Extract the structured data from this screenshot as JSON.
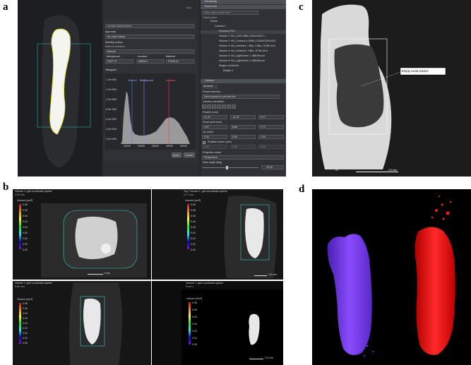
{
  "labels": {
    "a": "a",
    "b": "b",
    "c": "c",
    "d": "d"
  },
  "panel_a": {
    "input_placeholder": "Surface determination",
    "approach_label": "Approach",
    "approach_value": "Iso value based",
    "starting_contour_label": "Starting contour",
    "material_def_label": "Material definition",
    "material_def_value": "Manual",
    "background_label": "Background",
    "isovalue_label": "Isovalue",
    "material_label": "Material",
    "background_value": "10077.9",
    "isovalue_value": "26698.3",
    "material_value": "57518.31",
    "histogram_label": "Histogram",
    "hist_ylabels": [
      "1.4e+004",
      "1.2e+004",
      "1.0e+004",
      "8.0e+003",
      "6.0e+003",
      "4.0e+003",
      "2.0e+003"
    ],
    "hist_xlabels": [
      "10000",
      "20000",
      "30000",
      "40000",
      "50000"
    ],
    "marker_material": "Material",
    "marker_background": "Background",
    "marker_iso": "Isovalue",
    "ok_button": "Apply",
    "cancel_button": "Cancel",
    "rendering_label": "Rendering",
    "scene_tree_label": "Scene tree",
    "search_placeholder": "Enter object name here",
    "object_name_label": "Object name",
    "tree_items": [
      "Scene",
      "Camera 1",
      "Extracted ROI",
      "Volume 1: W1_Cell 0-8Bit | 1024x1024 x...",
      "Volume 2: W1_Contour-4-16Bit | 1024x1024x1024",
      "Volume 3: W1_surface4: 1 Bits, 2 Bits, 10 Bit x2x4",
      "Volume 4: W1_surface4: 1 Bits, 10 Bit x2x4",
      "Volume 5: W1_LightGreen 1: 8Bit1bit.set",
      "Volume 6: W1_LightGreen 2: 8Bit2bit.set",
      "Region of interest",
      "Region 1"
    ],
    "camera_label": "Camera",
    "general_tab": "General",
    "preset_label": "Preset selection",
    "preset_value": "Select preset to preview the...",
    "camera_orientation_label": "Camera orientation",
    "position_label": "Position (mm)",
    "position_values": [
      "21.37",
      "-11.37",
      "8.77"
    ],
    "focal_label": "Focal point (mm)",
    "focal_values": [
      "4.97",
      "8.68",
      "3.77"
    ],
    "up_label": "Up vector",
    "up_values": [
      "0.00",
      "0.00",
      "1.00"
    ],
    "rotation_label": "Rotation center (mm)",
    "rotation_values": [
      "0.00",
      "0.00",
      "0.00"
    ],
    "projection_label": "Projection mode",
    "projection_value": "Perspective",
    "view_angle_label": "View angle (deg)",
    "view_angle_value": "40.00",
    "right_corner": "Right"
  },
  "panel_b": {
    "q1_title": "Volume 1: grid coordinate system",
    "q1_sub": "0.00 mm",
    "q2_title": "Top / Volume 1: grid coordinate system",
    "q2_sub": "0.77 mm",
    "q3_title": "Volume 1: grid coordinate system",
    "q3_sub": "0.80 mm",
    "q4_title": "Volume 1: grid coordinate system",
    "q4_sub": "Front 1",
    "legend_title": "Volume [mm³]",
    "legend_ticks": [
      "0.06",
      "0.05",
      "0.04",
      "0.04",
      "0.03",
      "0.02",
      "0.02",
      "0.01",
      "0.00"
    ],
    "legend_ticks_q4": [
      "0.06",
      "0.05",
      "0.04",
      "0.03",
      "0.02",
      "0.01",
      "0.00"
    ],
    "scale_q1": "1 mm",
    "scale_q2": "2.5 mm",
    "scale_q4": "2.5 mm"
  },
  "panel_c": {
    "callout": "Empty canal volume",
    "scale_label": "2.5 mm",
    "corner_text": "n5"
  },
  "colors": {
    "ui_dark": "#2b2d31",
    "histogram_fill": "#9a9a9a",
    "marker_blue": "#5577ff",
    "marker_red": "#ff3333",
    "contour_yellow": "#e6e63a",
    "cyan_box": "#2fc9c9",
    "purple_volume": "#7a3cff",
    "red_volume": "#ff1a1a"
  }
}
